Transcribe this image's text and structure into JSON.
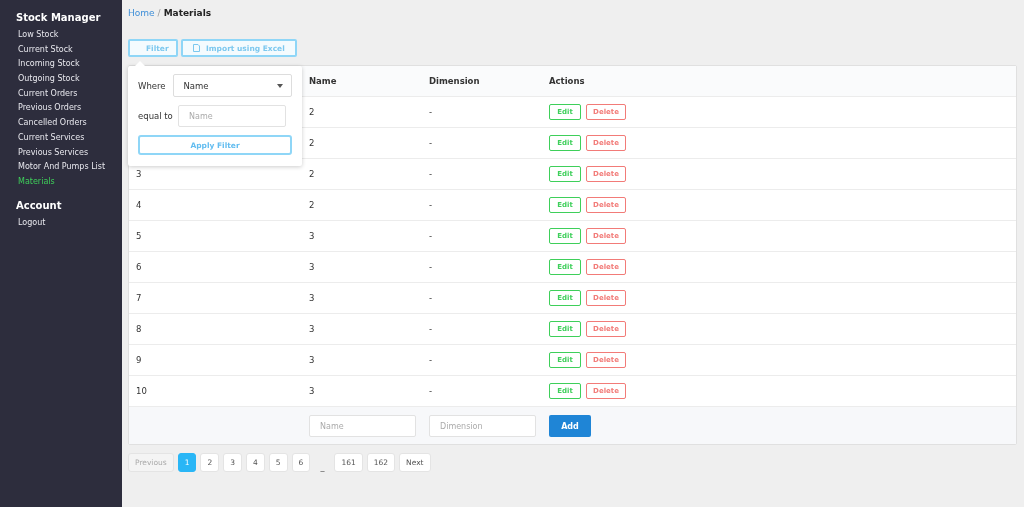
{
  "sidebar": {
    "sections": [
      {
        "title": "Stock Manager",
        "items": [
          {
            "label": "Low Stock",
            "selected": false
          },
          {
            "label": "Current Stock",
            "selected": false
          },
          {
            "label": "Incoming Stock",
            "selected": false
          },
          {
            "label": "Outgoing Stock",
            "selected": false
          },
          {
            "label": "Current Orders",
            "selected": false
          },
          {
            "label": "Previous Orders",
            "selected": false
          },
          {
            "label": "Cancelled Orders",
            "selected": false
          },
          {
            "label": "Current Services",
            "selected": false
          },
          {
            "label": "Previous Services",
            "selected": false
          },
          {
            "label": "Motor And Pumps List",
            "selected": false
          },
          {
            "label": "Materials",
            "selected": true
          }
        ]
      },
      {
        "title": "Account",
        "items": [
          {
            "label": "Logout",
            "selected": false
          }
        ]
      }
    ]
  },
  "breadcrumb": {
    "link": "Home",
    "separator": "/",
    "current": "Materials"
  },
  "toolbar": {
    "filter_button": "Filter",
    "import_button": "Import using Excel"
  },
  "filter_popover": {
    "where_label": "Where",
    "where_value": "Name",
    "equal_label": "equal to",
    "value_placeholder": "Name",
    "apply_button": "Apply Filter"
  },
  "table": {
    "columns": [
      "Name",
      "Dimension",
      "Actions"
    ],
    "rows": [
      {
        "name": "2",
        "dimension": "-",
        "edit": "Edit",
        "delete": "Delete"
      },
      {
        "name": "2",
        "dimension": "-",
        "edit": "Edit",
        "delete": "Delete"
      },
      {
        "id": "3",
        "name": "2",
        "dimension": "-",
        "edit": "Edit",
        "delete": "Delete"
      },
      {
        "id": "4",
        "name": "2",
        "dimension": "-",
        "edit": "Edit",
        "delete": "Delete"
      },
      {
        "id": "5",
        "name": "3",
        "dimension": "-",
        "edit": "Edit",
        "delete": "Delete"
      },
      {
        "id": "6",
        "name": "3",
        "dimension": "-",
        "edit": "Edit",
        "delete": "Delete"
      },
      {
        "id": "7",
        "name": "3",
        "dimension": "-",
        "edit": "Edit",
        "delete": "Delete"
      },
      {
        "id": "8",
        "name": "3",
        "dimension": "-",
        "edit": "Edit",
        "delete": "Delete"
      },
      {
        "id": "9",
        "name": "3",
        "dimension": "-",
        "edit": "Edit",
        "delete": "Delete"
      },
      {
        "id": "10",
        "name": "3",
        "dimension": "-",
        "edit": "Edit",
        "delete": "Delete"
      }
    ],
    "add_row": {
      "name_placeholder": "Name",
      "dimension_placeholder": "Dimension",
      "add_button": "Add"
    }
  },
  "pagination": {
    "previous": "Previous",
    "pages": [
      {
        "kind": "page",
        "label": "1",
        "selected": true
      },
      {
        "kind": "page",
        "label": "2",
        "selected": false
      },
      {
        "kind": "page",
        "label": "3",
        "selected": false
      },
      {
        "kind": "page",
        "label": "4",
        "selected": false
      },
      {
        "kind": "page",
        "label": "5",
        "selected": false
      },
      {
        "kind": "page",
        "label": "6",
        "selected": false
      },
      {
        "kind": "ellipsis",
        "label": "_"
      },
      {
        "kind": "page",
        "label": "161",
        "selected": false
      },
      {
        "kind": "page",
        "label": "162",
        "selected": false
      }
    ],
    "next": "Next"
  }
}
